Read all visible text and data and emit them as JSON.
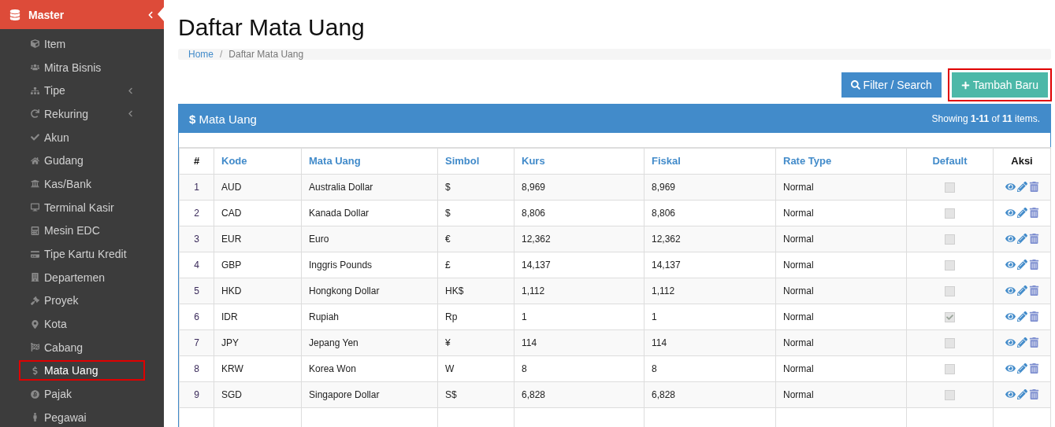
{
  "sidebar": {
    "header": {
      "label": "Master",
      "expanded": true
    },
    "items": [
      {
        "label": "Item",
        "expandable": false,
        "selected": false,
        "highlighted": false
      },
      {
        "label": "Mitra Bisnis",
        "expandable": false,
        "selected": false,
        "highlighted": false
      },
      {
        "label": "Tipe",
        "expandable": true,
        "selected": false,
        "highlighted": false
      },
      {
        "label": "Rekuring",
        "expandable": true,
        "selected": false,
        "highlighted": false
      },
      {
        "label": "Akun",
        "expandable": false,
        "selected": false,
        "highlighted": false
      },
      {
        "label": "Gudang",
        "expandable": false,
        "selected": false,
        "highlighted": false
      },
      {
        "label": "Kas/Bank",
        "expandable": false,
        "selected": false,
        "highlighted": false
      },
      {
        "label": "Terminal Kasir",
        "expandable": false,
        "selected": false,
        "highlighted": false
      },
      {
        "label": "Mesin EDC",
        "expandable": false,
        "selected": false,
        "highlighted": false
      },
      {
        "label": "Tipe Kartu Kredit",
        "expandable": false,
        "selected": false,
        "highlighted": false
      },
      {
        "label": "Departemen",
        "expandable": false,
        "selected": false,
        "highlighted": false
      },
      {
        "label": "Proyek",
        "expandable": false,
        "selected": false,
        "highlighted": false
      },
      {
        "label": "Kota",
        "expandable": false,
        "selected": false,
        "highlighted": false
      },
      {
        "label": "Cabang",
        "expandable": false,
        "selected": false,
        "highlighted": false
      },
      {
        "label": "Mata Uang",
        "expandable": false,
        "selected": true,
        "highlighted": true
      },
      {
        "label": "Pajak",
        "expandable": false,
        "selected": false,
        "highlighted": false
      },
      {
        "label": "Pegawai",
        "expandable": false,
        "selected": false,
        "highlighted": false
      }
    ]
  },
  "page_title": "Daftar Mata Uang",
  "breadcrumb": [
    {
      "label": "Home",
      "kind": "link"
    },
    {
      "label": "/",
      "kind": "separator"
    },
    {
      "label": "Daftar Mata Uang",
      "kind": "current"
    }
  ],
  "buttons": [
    {
      "label": "Filter / Search",
      "kind": "filter",
      "highlighted": false
    },
    {
      "label": "Tambah Baru",
      "kind": "add",
      "highlighted": true
    }
  ],
  "panel": {
    "title": "**$** Mata Uang",
    "summary": "Showing **1-11** of **11** items."
  },
  "table": {
    "columns": [
      {
        "label": "#",
        "sortable": false
      },
      {
        "label": "Kode",
        "sortable": true
      },
      {
        "label": "Mata Uang",
        "sortable": true
      },
      {
        "label": "Simbol",
        "sortable": true
      },
      {
        "label": "Kurs",
        "sortable": true
      },
      {
        "label": "Fiskal",
        "sortable": true
      },
      {
        "label": "Rate Type",
        "sortable": true
      },
      {
        "label": "Default",
        "sortable": true
      },
      {
        "label": "Aksi",
        "sortable": false
      }
    ],
    "rows": [
      {
        "no": "1",
        "kode": "AUD",
        "mata_uang": "Australia Dollar",
        "simbol": "$",
        "kurs": "8,969",
        "fiskal": "8,969",
        "rate_type": "Normal",
        "default": false
      },
      {
        "no": "2",
        "kode": "CAD",
        "mata_uang": "Kanada Dollar",
        "simbol": "$",
        "kurs": "8,806",
        "fiskal": "8,806",
        "rate_type": "Normal",
        "default": false
      },
      {
        "no": "3",
        "kode": "EUR",
        "mata_uang": "Euro",
        "simbol": "€",
        "kurs": "12,362",
        "fiskal": "12,362",
        "rate_type": "Normal",
        "default": false
      },
      {
        "no": "4",
        "kode": "GBP",
        "mata_uang": "Inggris Pounds",
        "simbol": "£",
        "kurs": "14,137",
        "fiskal": "14,137",
        "rate_type": "Normal",
        "default": false
      },
      {
        "no": "5",
        "kode": "HKD",
        "mata_uang": "Hongkong Dollar",
        "simbol": "HK$",
        "kurs": "1,112",
        "fiskal": "1,112",
        "rate_type": "Normal",
        "default": false
      },
      {
        "no": "6",
        "kode": "IDR",
        "mata_uang": "Rupiah",
        "simbol": "Rp",
        "kurs": "1",
        "fiskal": "1",
        "rate_type": "Normal",
        "default": true
      },
      {
        "no": "7",
        "kode": "JPY",
        "mata_uang": "Jepang Yen",
        "simbol": "¥",
        "kurs": "114",
        "fiskal": "114",
        "rate_type": "Normal",
        "default": false
      },
      {
        "no": "8",
        "kode": "KRW",
        "mata_uang": "Korea Won",
        "simbol": "W",
        "kurs": "8",
        "fiskal": "8",
        "rate_type": "Normal",
        "default": false
      },
      {
        "no": "9",
        "kode": "SGD",
        "mata_uang": "Singapore Dollar",
        "simbol": "S$",
        "kurs": "6,828",
        "fiskal": "6,828",
        "rate_type": "Normal",
        "default": false
      }
    ]
  }
}
